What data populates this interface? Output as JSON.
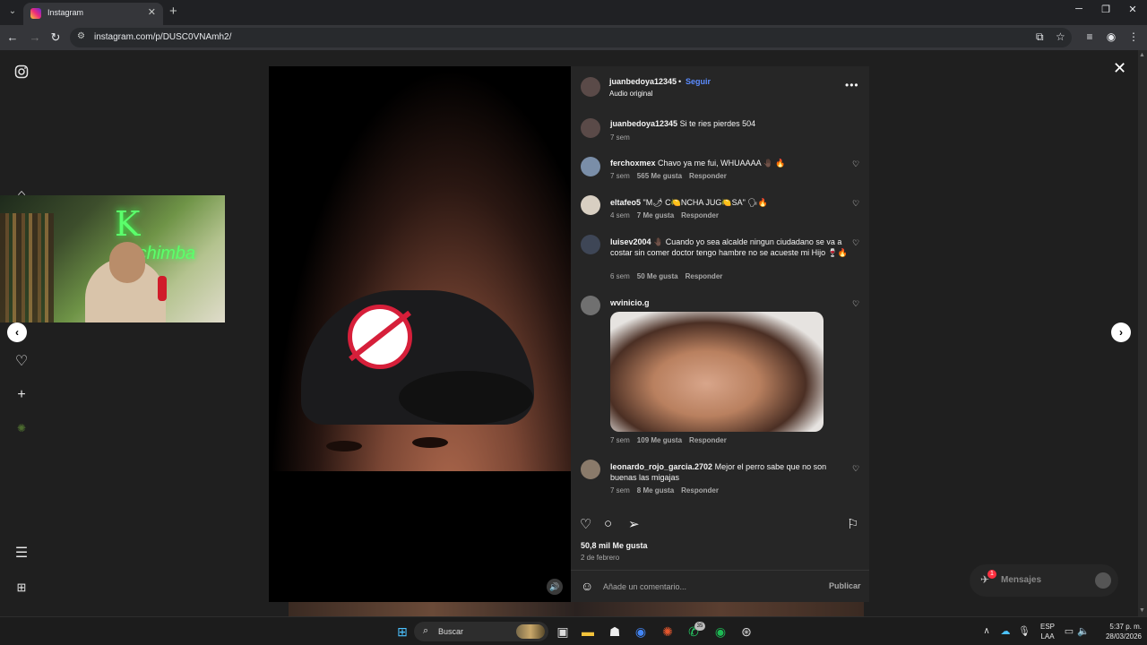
{
  "browser": {
    "tab_title": "Instagram",
    "url": "instagram.com/p/DUSC0VNAmh2/"
  },
  "post": {
    "username": "juanbedoya12345",
    "follow": "Seguir",
    "separator": "•",
    "audio": "Audio original",
    "caption_user": "juanbedoya12345",
    "caption_text": "Si te ries pierdes 504",
    "caption_time": "7 sem",
    "likes": "50,8 mil Me gusta",
    "date": "2 de febrero",
    "comment_placeholder": "Añade un comentario...",
    "publish": "Publicar"
  },
  "comments": [
    {
      "user": "ferchoxmex",
      "text": "Chavo ya me fui, WHUAAAA 🤚🏿 🔥",
      "time": "7 sem",
      "likes": "565 Me gusta",
      "reply": "Responder"
    },
    {
      "user": "eltafeo5",
      "text": "\"M🌶 C🍋NCHA JUG🍋SA\" 🗣🔥",
      "time": "4 sem",
      "likes": "7 Me gusta",
      "reply": "Responder"
    },
    {
      "user": "luisev2004",
      "text": "🤚🏿 Cuando yo sea alcalde ningun ciudadano se va a costar sin comer doctor tengo hambre no se acueste mi Hijo 🍷🔥",
      "time": "6 sem",
      "likes": "50 Me gusta",
      "reply": "Responder"
    },
    {
      "user": "wvinicio.g",
      "text": "",
      "time": "7 sem",
      "likes": "109 Me gusta",
      "reply": "Responder"
    },
    {
      "user": "leonardo_rojo_garcia.2702",
      "text": "Mejor el perro sabe que no son buenas las migajas",
      "time": "7 sem",
      "likes": "8 Me gusta",
      "reply": "Responder"
    }
  ],
  "messages": {
    "label": "Mensajes",
    "badge": "1"
  },
  "webcam_sign": {
    "line1": "K",
    "line2": "wachimba"
  },
  "taskbar": {
    "search_label": "Buscar",
    "whatsapp_badge": "35",
    "lang": "ESP",
    "layout": "LAA",
    "time": "5:37 p. m.",
    "date": "28/03/2026"
  },
  "icons": [
    "instagram-icon",
    "home-icon",
    "heart-icon",
    "plus-icon",
    "threads-icon",
    "menu-icon",
    "more-icon",
    "chevron-left-icon",
    "chevron-right-icon",
    "close-icon",
    "speaker-icon",
    "comment-icon",
    "share-icon",
    "bookmark-icon",
    "emoji-icon"
  ]
}
